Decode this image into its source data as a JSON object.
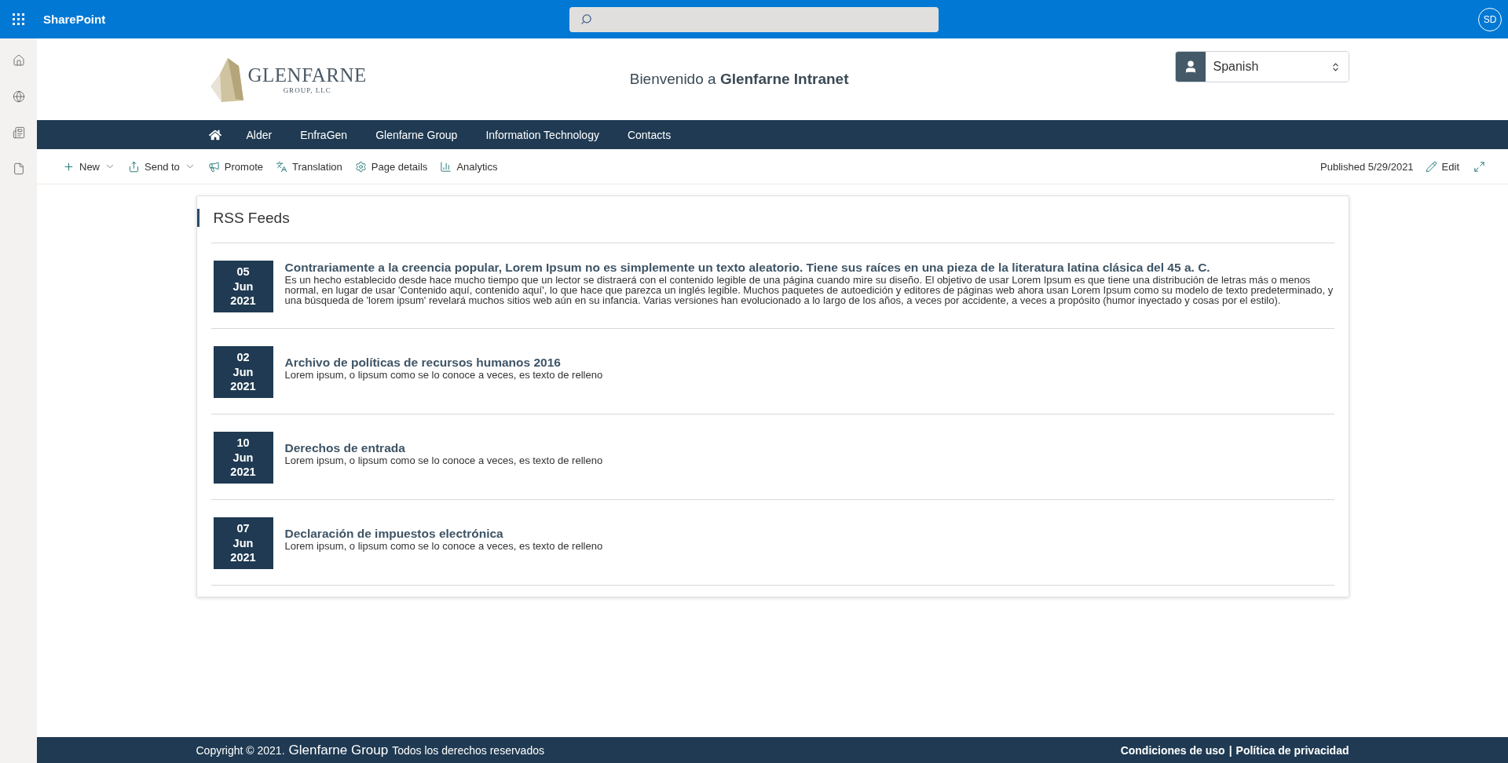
{
  "suite_bar": {
    "app_name": "SharePoint",
    "avatar_initials": "SD"
  },
  "header": {
    "logo": {
      "name": "GLENFARNE",
      "subtitle": "GROUP, LLC"
    },
    "welcome": "Bienvenido a **Glenfarne Intranet**",
    "language": {
      "value": "Spanish"
    }
  },
  "nav": {
    "items": [
      "Alder",
      "EnfraGen",
      "Glenfarne Group",
      "Information Technology",
      "Contacts"
    ]
  },
  "command_bar": {
    "items": [
      {
        "label": "New",
        "has_menu": true
      },
      {
        "label": "Send to",
        "has_menu": true
      },
      {
        "label": "Promote",
        "has_menu": false
      },
      {
        "label": "Translation",
        "has_menu": false
      },
      {
        "label": "Page details",
        "has_menu": false
      },
      {
        "label": "Analytics",
        "has_menu": false
      }
    ],
    "published": "Published 5/29/2021",
    "edit": "Edit"
  },
  "rss": {
    "title": "RSS Feeds",
    "items": [
      {
        "day": "05",
        "month": "Jun",
        "year": "2021",
        "title": "Contrariamente a la creencia popular, Lorem Ipsum no es simplemente un texto aleatorio. Tiene sus raíces en una pieza de la literatura latina clásica del 45 a. C.",
        "description": "Es un hecho establecido desde hace mucho tiempo que un lector se distraerá con el contenido legible de una página cuando mire su diseño. El objetivo de usar Lorem Ipsum es que tiene una distribución de letras más o menos normal, en lugar de usar 'Contenido aquí, contenido aquí', lo que hace que parezca un inglés legible. Muchos paquetes de autoedición y editores de páginas web ahora usan Lorem Ipsum como su modelo de texto predeterminado, y una búsqueda de 'lorem ipsum' revelará muchos sitios web aún en su infancia. Varias versiones han evolucionado a lo largo de los años, a veces por accidente, a veces a propósito (humor inyectado y cosas por el estilo)."
      },
      {
        "day": "02",
        "month": "Jun",
        "year": "2021",
        "title": "Archivo de políticas de recursos humanos 2016",
        "description": "Lorem ipsum, o lipsum como se lo conoce a veces, es texto de relleno"
      },
      {
        "day": "10",
        "month": "Jun",
        "year": "2021",
        "title": "Derechos de entrada",
        "description": "Lorem ipsum, o lipsum como se lo conoce a veces, es texto de relleno"
      },
      {
        "day": "07",
        "month": "Jun",
        "year": "2021",
        "title": "Declaración de impuestos electrónica",
        "description": "Lorem ipsum, o lipsum como se lo conoce a veces, es texto de relleno"
      }
    ]
  },
  "footer": {
    "copyright": "Copyright © 2021.",
    "company": "Glenfarne Group",
    "rights": "Todos los derechos reservados",
    "links": [
      "Condiciones de uso",
      "Política de privacidad"
    ],
    "separator": "|"
  }
}
